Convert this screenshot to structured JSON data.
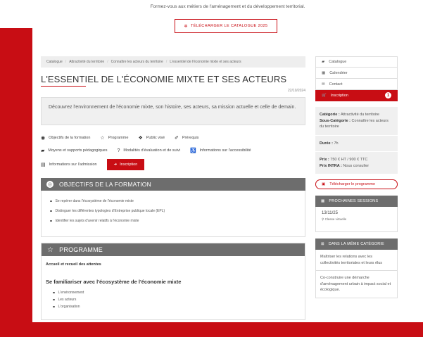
{
  "banner": {
    "text": "Formez-vous aux métiers de l'aménagement et du développement territorial.",
    "catalogue_button": "TÉLÉCHARGER LE CATALOGUE 2025"
  },
  "breadcrumb": [
    "Catalogue",
    "Attractivité du territoire",
    "Connaître les acteurs du territoire",
    "L'essentiel de l'économie mixte et ses acteurs"
  ],
  "page": {
    "title": "L'ESSENTIEL DE L'ÉCONOMIE MIXTE ET SES ACTEURS",
    "date": "22/10/2024",
    "intro": "Découvrez l'environnement de l'économie mixte, son histoire, ses acteurs, sa mission actuelle et celle de demain."
  },
  "nav": {
    "row1": [
      "Objectifs de la formation",
      "Programme",
      "Public visé",
      "Prérequis"
    ],
    "row2": [
      "Moyens et supports pédagogiques",
      "Modalités d'évaluation et de suivi",
      "Informations sur l'accessibilité"
    ],
    "row3": [
      "Informations sur l'admission"
    ],
    "inscription": "Inscription"
  },
  "objectifs": {
    "title": "OBJECTIFS DE LA FORMATION",
    "items": [
      "Se repérer dans l'écosystème de l'économie mixte",
      "Distinguer les différentes typologies d'Entreprise publique locale (EPL)",
      "Identifier les sujets d'avenir relatifs à l'économie mixte"
    ]
  },
  "programme": {
    "title": "PROGRAMME",
    "subtitle": "Accueil et recueil des attentes",
    "heading": "Se familiariser avec l'écosystème de l'économie mixte",
    "items": [
      "L'environnement",
      "Les acteurs",
      "L'organisation"
    ]
  },
  "sidebar": {
    "menu": [
      "Catalogue",
      "Calendrier",
      "Contact"
    ],
    "inscription": "Inscription",
    "badge": "1",
    "info": {
      "categorie_label": "Catégorie :",
      "categorie_value": "Attractivité du territoire",
      "souscat_label": "Sous-Catégorie :",
      "souscat_value": "Connaître les acteurs du territoire",
      "duree_label": "Durée :",
      "duree_value": "7h",
      "prix_label": "Prix :",
      "prix_value": "750 € HT / 900 € TTC",
      "prix_intra_label": "Prix INTRA :",
      "prix_intra_value": "Nous consulter"
    },
    "download": "Télécharger le programme",
    "sessions_title": "PROCHAINES SESSIONS",
    "session_date": "13/11/25",
    "session_place": "Classe virtuelle",
    "same_cat_title": "DANS LA MÊME CATÉGORIE",
    "same_cat": [
      "Maîtriser les relations avec les collectivités territoriales et leurs élus",
      "Co-construire une démarche d'aménagement urbain à impact social et écologique."
    ]
  },
  "colors": {
    "accent": "#c80d14",
    "section": "#6d6d6d"
  }
}
